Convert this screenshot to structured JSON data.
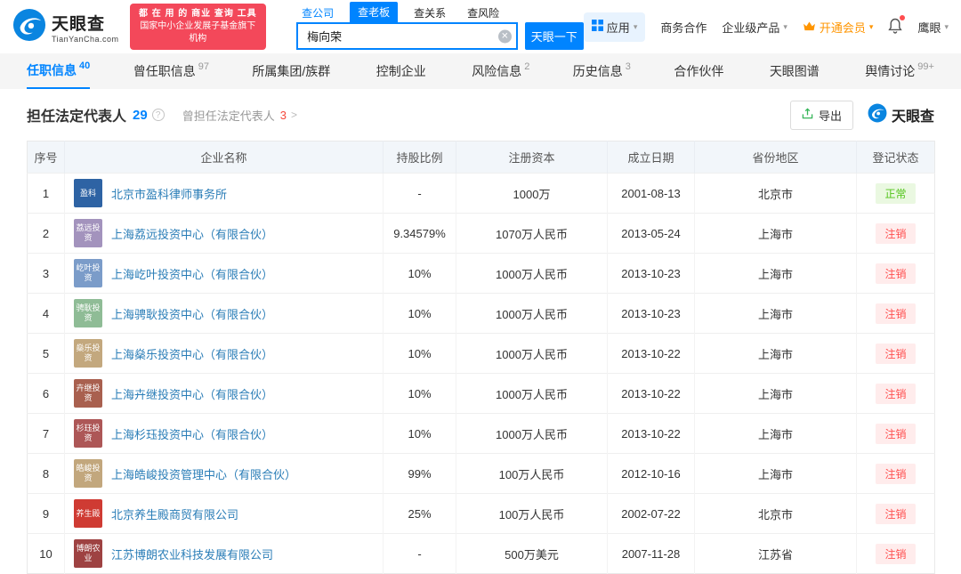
{
  "header": {
    "logo": {
      "title": "天眼查",
      "subtitle": "TianYanCha.com"
    },
    "promo": {
      "line1": "都 在 用 的 商业 查询 工具",
      "line2": "国家中小企业发展子基金旗下机构"
    },
    "search": {
      "tabs": [
        {
          "label": "查公司",
          "variant": "link"
        },
        {
          "label": "查老板",
          "variant": "active"
        },
        {
          "label": "查关系",
          "variant": "plain"
        },
        {
          "label": "查风险",
          "variant": "plain"
        }
      ],
      "value": "梅向荣",
      "button_label": "天眼一下"
    },
    "menu": {
      "apps": "应用",
      "cooperation": "商务合作",
      "enterprise": "企业级产品",
      "vip": "开通会员",
      "eagle": "鹰眼"
    }
  },
  "nav": {
    "tabs": [
      {
        "label": "任职信息",
        "count": "40",
        "active": true
      },
      {
        "label": "曾任职信息",
        "count": "97",
        "active": false
      },
      {
        "label": "所属集团/族群",
        "count": "",
        "active": false
      },
      {
        "label": "控制企业",
        "count": "",
        "active": false
      },
      {
        "label": "风险信息",
        "count": "2",
        "active": false
      },
      {
        "label": "历史信息",
        "count": "3",
        "active": false
      },
      {
        "label": "合作伙伴",
        "count": "",
        "active": false
      },
      {
        "label": "天眼图谱",
        "count": "",
        "active": false
      },
      {
        "label": "舆情讨论",
        "count": "99+",
        "active": false
      }
    ]
  },
  "section": {
    "title": "担任法定代表人",
    "count": "29",
    "help_icon": "?",
    "sub_title": "曾担任法定代表人",
    "sub_count": "3",
    "sub_arrow": ">",
    "export_label": "导出",
    "watermark": "天眼查"
  },
  "table": {
    "columns": [
      "序号",
      "企业名称",
      "持股比例",
      "注册资本",
      "成立日期",
      "省份地区",
      "登记状态"
    ],
    "rows": [
      {
        "no": "1",
        "name": "北京市盈科律师事务所",
        "logo_text": "盈科",
        "logo_color": "#2e63a4",
        "ratio": "-",
        "capital": "1000万",
        "date": "2001-08-13",
        "region": "北京市",
        "status": "正常",
        "status_type": "normal"
      },
      {
        "no": "2",
        "name": "上海荔远投资中心（有限合伙）",
        "logo_text": "荔远投资",
        "logo_color": "#a393bd",
        "ratio": "9.34579%",
        "capital": "1070万人民币",
        "date": "2013-05-24",
        "region": "上海市",
        "status": "注销",
        "status_type": "cancelled"
      },
      {
        "no": "3",
        "name": "上海屹叶投资中心（有限合伙）",
        "logo_text": "屹叶投资",
        "logo_color": "#7b9cc9",
        "ratio": "10%",
        "capital": "1000万人民币",
        "date": "2013-10-23",
        "region": "上海市",
        "status": "注销",
        "status_type": "cancelled"
      },
      {
        "no": "4",
        "name": "上海骋耿投资中心（有限合伙）",
        "logo_text": "骋耿投资",
        "logo_color": "#8fbc96",
        "ratio": "10%",
        "capital": "1000万人民币",
        "date": "2013-10-23",
        "region": "上海市",
        "status": "注销",
        "status_type": "cancelled"
      },
      {
        "no": "5",
        "name": "上海燊乐投资中心（有限合伙）",
        "logo_text": "燊乐投资",
        "logo_color": "#c3a87e",
        "ratio": "10%",
        "capital": "1000万人民币",
        "date": "2013-10-22",
        "region": "上海市",
        "status": "注销",
        "status_type": "cancelled"
      },
      {
        "no": "6",
        "name": "上海卉继投资中心（有限合伙）",
        "logo_text": "卉继投资",
        "logo_color": "#a9604f",
        "ratio": "10%",
        "capital": "1000万人民币",
        "date": "2013-10-22",
        "region": "上海市",
        "status": "注销",
        "status_type": "cancelled"
      },
      {
        "no": "7",
        "name": "上海杉珏投资中心（有限合伙）",
        "logo_text": "杉珏投资",
        "logo_color": "#ad5757",
        "ratio": "10%",
        "capital": "1000万人民币",
        "date": "2013-10-22",
        "region": "上海市",
        "status": "注销",
        "status_type": "cancelled"
      },
      {
        "no": "8",
        "name": "上海皓峻投资管理中心（有限合伙）",
        "logo_text": "皓峻投资",
        "logo_color": "#c2a77d",
        "ratio": "99%",
        "capital": "100万人民币",
        "date": "2012-10-16",
        "region": "上海市",
        "status": "注销",
        "status_type": "cancelled"
      },
      {
        "no": "9",
        "name": "北京养生殿商贸有限公司",
        "logo_text": "养生殿",
        "logo_color": "#cf3b33",
        "ratio": "25%",
        "capital": "100万人民币",
        "date": "2002-07-22",
        "region": "北京市",
        "status": "注销",
        "status_type": "cancelled"
      },
      {
        "no": "10",
        "name": "江苏博朗农业科技发展有限公司",
        "logo_text": "博朗农业",
        "logo_color": "#9e4242",
        "ratio": "-",
        "capital": "500万美元",
        "date": "2007-11-28",
        "region": "江苏省",
        "status": "注销",
        "status_type": "cancelled"
      }
    ]
  },
  "colors": {
    "accent": "#0084ff",
    "link": "#2a7db7",
    "normal_green": "#52c41a",
    "cancelled_red": "#ff5050",
    "vip_orange": "#ff9500",
    "promo_red": "#f3485a"
  }
}
